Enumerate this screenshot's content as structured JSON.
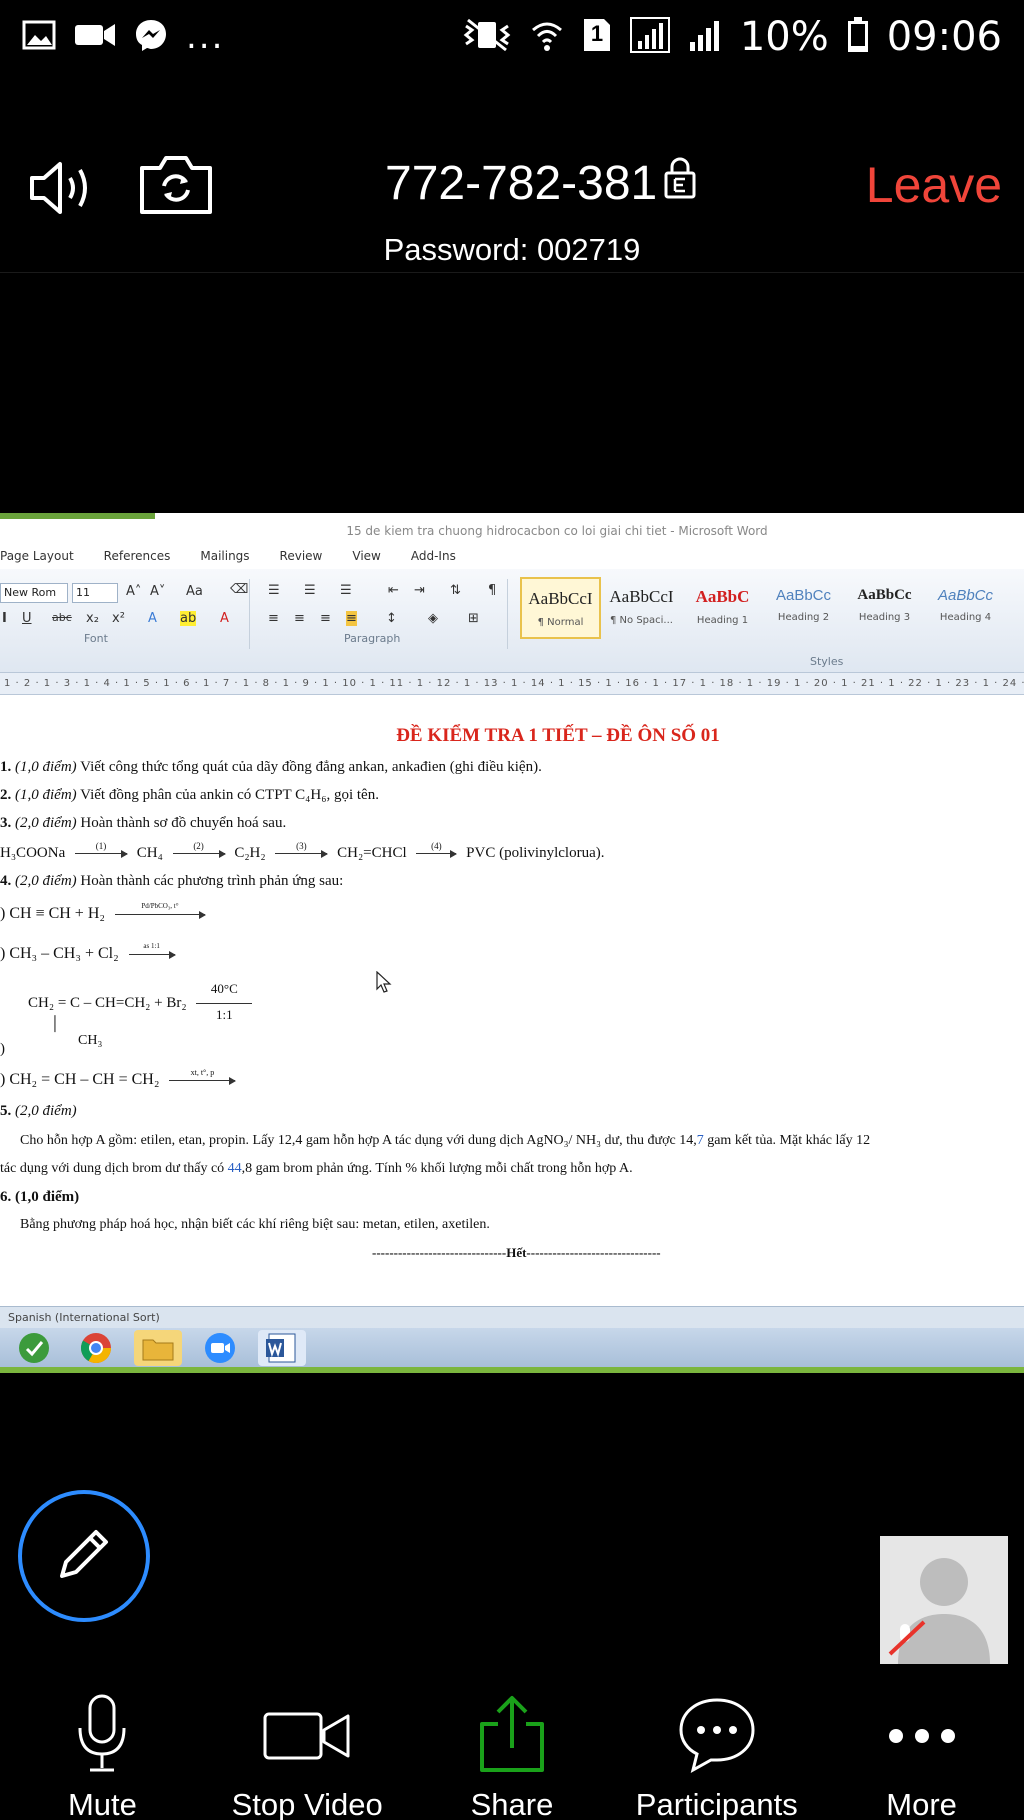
{
  "status_bar": {
    "dots": "...",
    "sim": "1",
    "battery": "10%",
    "time": "09:06"
  },
  "meeting": {
    "id": "772-782-381",
    "password": "Password: 002719",
    "leave_label": "Leave",
    "leave_color": "#f0453a"
  },
  "shared_screen": {
    "window_title": "15 de kiem tra chuong hidrocacbon co loi giai chi tiet - Microsoft Word",
    "tabs": [
      "Page Layout",
      "References",
      "Mailings",
      "Review",
      "View",
      "Add-Ins"
    ],
    "font_name": "New Rom",
    "font_size": "11",
    "font_group_label": "Font",
    "paragraph_group_label": "Paragraph",
    "styles_group_label": "Styles",
    "styles": [
      {
        "sample": "AaBbCcI",
        "name": "¶ Normal"
      },
      {
        "sample": "AaBbCcI",
        "name": "¶ No Spaci..."
      },
      {
        "sample": "AaBbC",
        "name": "Heading 1"
      },
      {
        "sample": "AaBbCc",
        "name": "Heading 2"
      },
      {
        "sample": "AaBbCc",
        "name": "Heading 3"
      },
      {
        "sample": "AaBbCc",
        "name": "Heading 4"
      }
    ],
    "ruler_text": "1 · 2 · 1 · 3 · 1 · 4 · 1 · 5 · 1 · 6 · 1 · 7 · 1 · 8 · 1 · 9 · 1 · 10 · 1 · 11 · 1 · 12 · 1 · 13 · 1 · 14 · 1 · 15 · 1 · 16 · 1 · 17 · 1 · 18 · 1 · 19 · 1 · 20 · 1 · 21 · 1 · 22 · 1 · 23 · 1 · 24 ·",
    "document": {
      "title": "ĐỀ KIỂM TRA 1 TIẾT – ĐỀ ÔN SỐ 01",
      "q1_num": "1.",
      "q1_points": "(1,0 điểm)",
      "q1_text": "Viết công thức tổng quát của dãy đồng đẳng ankan, ankađien (ghi điều kiện).",
      "q2_num": "2.",
      "q2_points": "(1,0 điểm)",
      "q2_text": "Viết đồng phân của ankin có CTPT C₄H₆, gọi tên.",
      "q3_num": "3.",
      "q3_points": "(2,0 điểm)",
      "q3_text": "Hoàn thành sơ đồ chuyển hoá sau.",
      "scheme_start": "H₃COONa",
      "scheme_ch4": "CH₄",
      "scheme_c2h2": "C₂H₂",
      "scheme_vc": "CH₂=CHCl",
      "scheme_end": "PVC (polivinylclorua).",
      "scheme_labels": [
        "(1)",
        "(2)",
        "(3)",
        "(4)"
      ],
      "q4_num": "4.",
      "q4_points": "(2,0 điểm)",
      "q4_text": "Hoàn thành các phương trình phản ứng sau:",
      "r1": ") CH ≡ CH + H₂",
      "r1_cond": "Pd/PbCO₃, t°",
      "r2": ") CH₃ – CH₃ + Cl₂",
      "r2_cond": "as 1:1",
      "r3": "CH₂ = C – CH=CH₂ + Br₂",
      "r3_sub": "CH₃",
      "r3_cond_top": "40°C",
      "r3_cond_bottom": "1:1",
      "r3_prefix": ")",
      "r4": ") CH₂ = CH – CH = CH₂",
      "r4_cond": "xt, t°, p",
      "q5_num": "5.",
      "q5_points": "(2,0 điểm)",
      "q5_line1_a": "Cho hỗn hợp A gồm: etilen, etan, propin. Lấy 12,4 gam hỗn hợp A tác dụng với dung dịch AgNO₃/ NH₃ dư, thu được 14,",
      "q5_line1_b": "7",
      "q5_line1_c": " gam kết tủa. Mặt khác lấy 12",
      "q5_line2_a": "tác dụng với dung dịch brom dư thấy có ",
      "q5_line2_b": "44",
      "q5_line2_c": ",8 gam brom phản ứng. Tính % khối lượng mỗi chất trong hỗn hợp A.",
      "q6_num": "6.",
      "q6_points": "(1,0 điểm)",
      "q6_text": "Bằng phương pháp hoá học, nhận biết các khí riêng biệt sau: metan, etilen, axetilen.",
      "end_marker": "-------------------------------Hết-------------------------------"
    },
    "language_status": "Spanish (International Sort)"
  },
  "toolbar": {
    "mute": "Mute",
    "stop_video": "Stop Video",
    "share": "Share",
    "participants": "Participants",
    "more": "More",
    "share_color": "#1aa11a"
  }
}
